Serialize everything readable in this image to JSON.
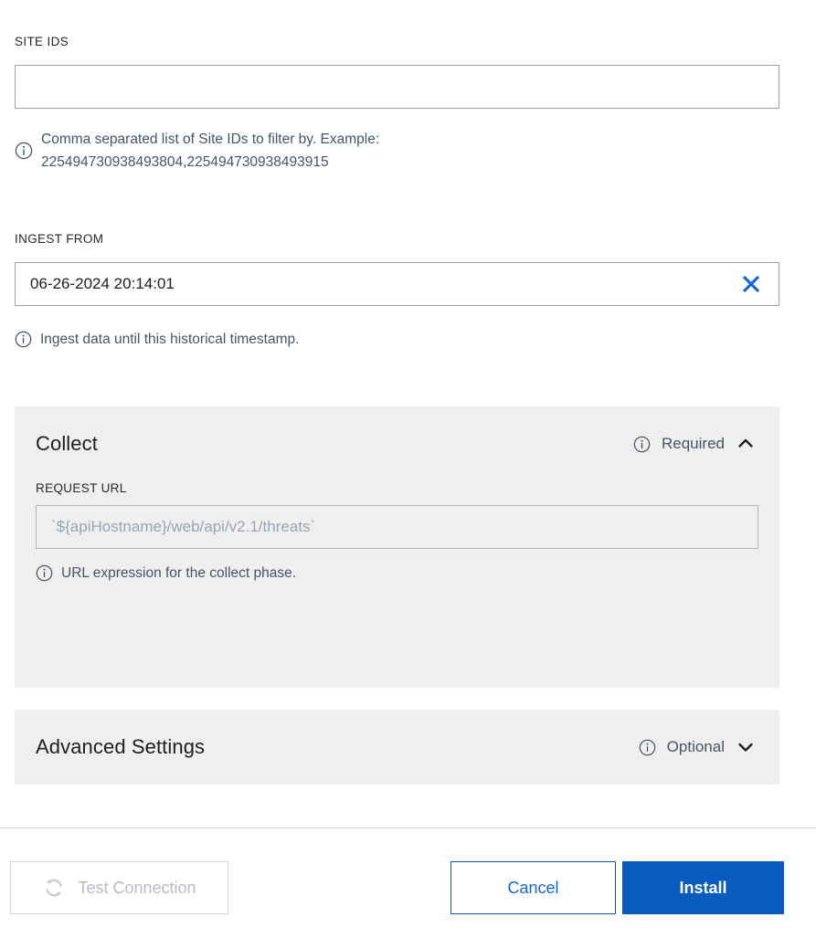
{
  "colors": {
    "accent": "#0a5bbf",
    "link": "#1367d0",
    "panel_bg": "#efefef",
    "page_bg": "#ffffff",
    "help_text": "#475467",
    "disabled_text": "#b8bcc2",
    "input_border": "#9b9fa4"
  },
  "fields": {
    "site_ids": {
      "label": "SITE IDS",
      "value": "",
      "placeholder": "",
      "help": "Comma separated list of Site IDs to filter by. Example:\n225494730938493804,225494730938493915",
      "info_icon": "info-circle-icon"
    },
    "ingest_from": {
      "label": "INGEST FROM",
      "value": "06-26-2024 20:14:01",
      "placeholder": "MM-DD-YYYY HH:mm:ss",
      "help": "Ingest data until this historical timestamp.",
      "info_icon": "info-circle-icon",
      "clear_icon": "close-x-icon"
    }
  },
  "panels": [
    {
      "title": "Collect",
      "badge": "Required",
      "badge_icon": "info-circle-icon",
      "chevron_icon": "chevron-up-icon",
      "expanded": true,
      "request_url": {
        "label": "REQUEST URL",
        "value": "",
        "placeholder": "`${apiHostname}/web/api/v2.1/threats`",
        "help": "URL expression for the collect phase.",
        "info_icon": "info-circle-icon"
      }
    },
    {
      "title": "Advanced Settings",
      "badge": "Optional",
      "badge_icon": "info-circle-icon",
      "chevron_icon": "chevron-down-icon",
      "expanded": false
    }
  ],
  "footer": {
    "test_connection": {
      "label": "Test Connection",
      "icon": "refresh-sync-icon",
      "disabled": true
    },
    "cancel": {
      "label": "Cancel"
    },
    "install": {
      "label": "Install"
    }
  }
}
